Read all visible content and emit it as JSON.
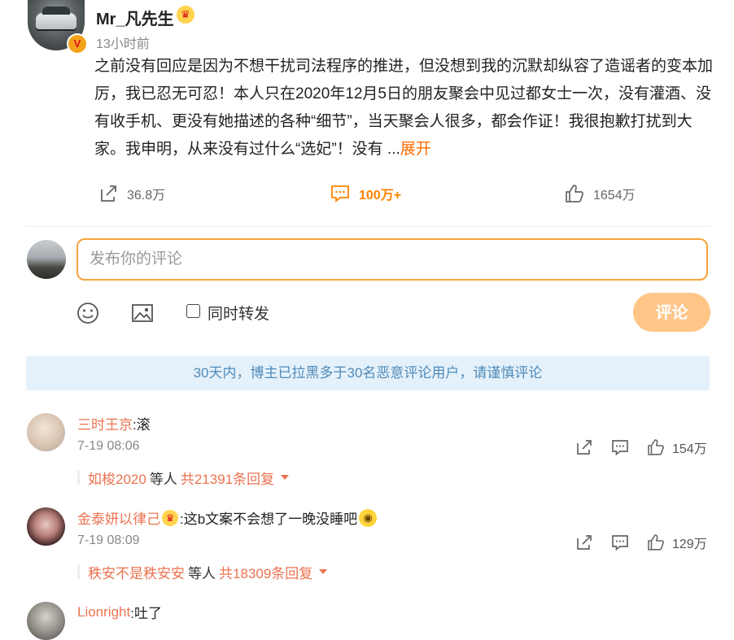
{
  "post": {
    "author": "Mr_凡先生",
    "verified_badge": "V",
    "vip_badge": "crown-icon",
    "time": "13小时前",
    "text": "之前没有回应是因为不想干扰司法程序的推进，但没想到我的沉默却纵容了造谣者的变本加厉，我已忍无可忍！本人只在2020年12月5日的朋友聚会中见过都女士一次，没有灌酒、没有收手机、更没有她描述的各种“细节”，当天聚会人很多，都会作证！我很抱歉打扰到大家。我申明，从来没有过什么“选妃”！没有 ...",
    "expand_label": "展开",
    "actions": {
      "share_count": "36.8万",
      "comment_count": "100万+",
      "like_count": "1654万"
    }
  },
  "composer": {
    "placeholder": "发布你的评论",
    "repost_label": "同时转发",
    "submit_label": "评论"
  },
  "notice": "30天内，博主已拉黑多于30名恶意评论用户，请谨慎评论",
  "comments": [
    {
      "user": "三时王京",
      "text": ":滚",
      "time": "7-19 08:06",
      "like_count": "154万",
      "reply_names": "如梭2020",
      "reply_mid": "等人",
      "reply_total": "共21391条回复"
    },
    {
      "user": "金泰妍以律己",
      "text": ":这b文案不会想了一晚没睡吧",
      "time": "7-19 08:09",
      "like_count": "129万",
      "reply_names": "秩安不是秩安安",
      "reply_mid": "等人",
      "reply_total": "共18309条回复"
    },
    {
      "user": "Lionright",
      "text": ":吐了"
    }
  ],
  "colors": {
    "accent_orange": "#ff8200",
    "username_orange": "#eb7350",
    "input_border": "#f5a43a",
    "submit_bg": "#ffc687",
    "notice_bg": "#e4f1fb",
    "notice_text": "#4f8ab8"
  }
}
